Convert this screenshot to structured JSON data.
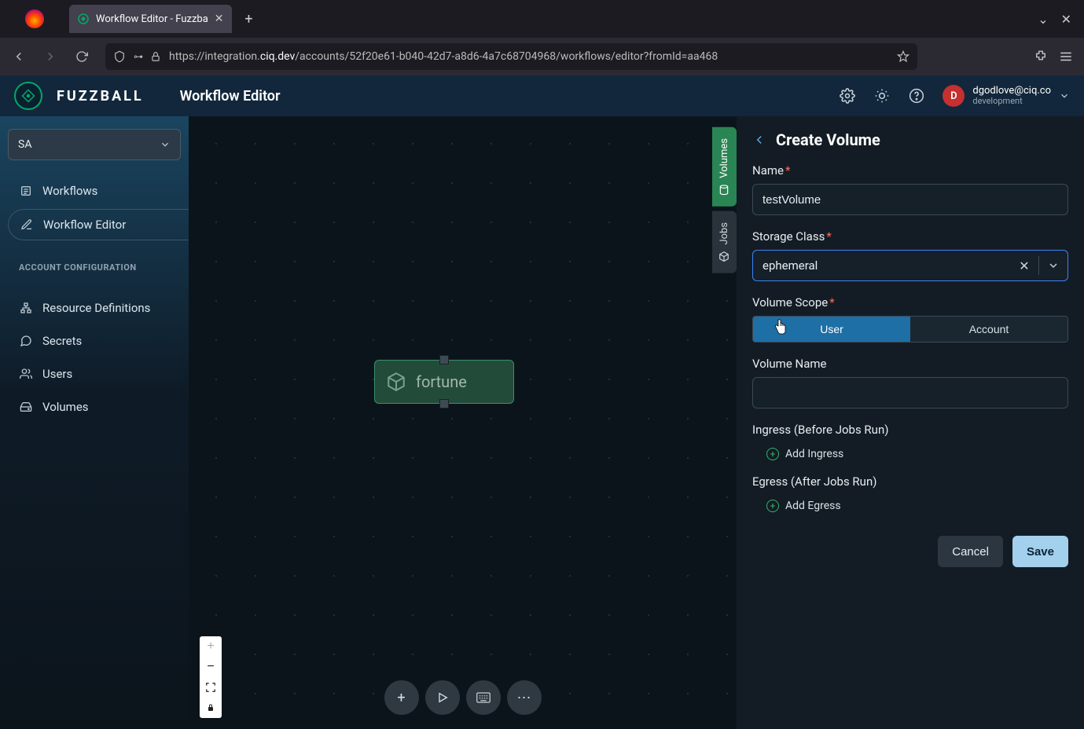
{
  "browser": {
    "tab_title": "Workflow Editor - Fuzzba",
    "url_prefix": "https://integration.",
    "url_domain": "ciq.dev",
    "url_path": "/accounts/52f20e61-b040-42d7-a8d6-4a7c68704968/workflows/editor?fromId=aa468"
  },
  "app": {
    "brand": "FUZZBALL",
    "header_title": "Workflow Editor",
    "user": {
      "initial": "D",
      "email": "dgodlove@ciq.co",
      "env": "development"
    }
  },
  "sidebar": {
    "account_selector": "SA",
    "items_main": [
      {
        "label": "Workflows",
        "icon": "list-icon"
      },
      {
        "label": "Workflow Editor",
        "icon": "edit-icon"
      }
    ],
    "section_label": "ACCOUNT CONFIGURATION",
    "items_config": [
      {
        "label": "Resource Definitions",
        "icon": "sitemap-icon"
      },
      {
        "label": "Secrets",
        "icon": "chat-icon"
      },
      {
        "label": "Users",
        "icon": "users-icon"
      },
      {
        "label": "Volumes",
        "icon": "disk-icon"
      }
    ]
  },
  "canvas": {
    "tabs": {
      "volumes": "Volumes",
      "jobs": "Jobs"
    },
    "node_label": "fortune"
  },
  "panel": {
    "title": "Create Volume",
    "name_label": "Name",
    "name_value": "testVolume",
    "storage_class_label": "Storage Class",
    "storage_class_value": "ephemeral",
    "volume_scope_label": "Volume Scope",
    "scope_options": {
      "user": "User",
      "account": "Account"
    },
    "volume_name_label": "Volume Name",
    "volume_name_value": "",
    "ingress_label": "Ingress (Before Jobs Run)",
    "add_ingress": "Add Ingress",
    "egress_label": "Egress (After Jobs Run)",
    "add_egress": "Add Egress",
    "cancel": "Cancel",
    "save": "Save"
  }
}
